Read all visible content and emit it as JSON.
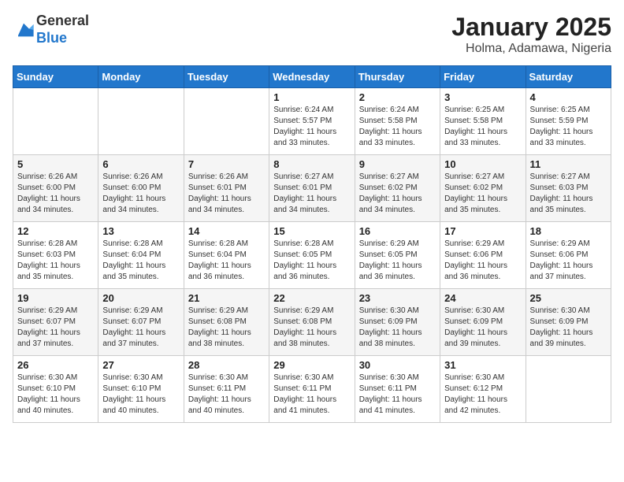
{
  "header": {
    "logo": {
      "line1": "General",
      "line2": "Blue"
    },
    "title": "January 2025",
    "subtitle": "Holma, Adamawa, Nigeria"
  },
  "weekdays": [
    "Sunday",
    "Monday",
    "Tuesday",
    "Wednesday",
    "Thursday",
    "Friday",
    "Saturday"
  ],
  "weeks": [
    [
      {
        "day": "",
        "info": ""
      },
      {
        "day": "",
        "info": ""
      },
      {
        "day": "",
        "info": ""
      },
      {
        "day": "1",
        "info": "Sunrise: 6:24 AM\nSunset: 5:57 PM\nDaylight: 11 hours and 33 minutes."
      },
      {
        "day": "2",
        "info": "Sunrise: 6:24 AM\nSunset: 5:58 PM\nDaylight: 11 hours and 33 minutes."
      },
      {
        "day": "3",
        "info": "Sunrise: 6:25 AM\nSunset: 5:58 PM\nDaylight: 11 hours and 33 minutes."
      },
      {
        "day": "4",
        "info": "Sunrise: 6:25 AM\nSunset: 5:59 PM\nDaylight: 11 hours and 33 minutes."
      }
    ],
    [
      {
        "day": "5",
        "info": "Sunrise: 6:26 AM\nSunset: 6:00 PM\nDaylight: 11 hours and 34 minutes."
      },
      {
        "day": "6",
        "info": "Sunrise: 6:26 AM\nSunset: 6:00 PM\nDaylight: 11 hours and 34 minutes."
      },
      {
        "day": "7",
        "info": "Sunrise: 6:26 AM\nSunset: 6:01 PM\nDaylight: 11 hours and 34 minutes."
      },
      {
        "day": "8",
        "info": "Sunrise: 6:27 AM\nSunset: 6:01 PM\nDaylight: 11 hours and 34 minutes."
      },
      {
        "day": "9",
        "info": "Sunrise: 6:27 AM\nSunset: 6:02 PM\nDaylight: 11 hours and 34 minutes."
      },
      {
        "day": "10",
        "info": "Sunrise: 6:27 AM\nSunset: 6:02 PM\nDaylight: 11 hours and 35 minutes."
      },
      {
        "day": "11",
        "info": "Sunrise: 6:27 AM\nSunset: 6:03 PM\nDaylight: 11 hours and 35 minutes."
      }
    ],
    [
      {
        "day": "12",
        "info": "Sunrise: 6:28 AM\nSunset: 6:03 PM\nDaylight: 11 hours and 35 minutes."
      },
      {
        "day": "13",
        "info": "Sunrise: 6:28 AM\nSunset: 6:04 PM\nDaylight: 11 hours and 35 minutes."
      },
      {
        "day": "14",
        "info": "Sunrise: 6:28 AM\nSunset: 6:04 PM\nDaylight: 11 hours and 36 minutes."
      },
      {
        "day": "15",
        "info": "Sunrise: 6:28 AM\nSunset: 6:05 PM\nDaylight: 11 hours and 36 minutes."
      },
      {
        "day": "16",
        "info": "Sunrise: 6:29 AM\nSunset: 6:05 PM\nDaylight: 11 hours and 36 minutes."
      },
      {
        "day": "17",
        "info": "Sunrise: 6:29 AM\nSunset: 6:06 PM\nDaylight: 11 hours and 36 minutes."
      },
      {
        "day": "18",
        "info": "Sunrise: 6:29 AM\nSunset: 6:06 PM\nDaylight: 11 hours and 37 minutes."
      }
    ],
    [
      {
        "day": "19",
        "info": "Sunrise: 6:29 AM\nSunset: 6:07 PM\nDaylight: 11 hours and 37 minutes."
      },
      {
        "day": "20",
        "info": "Sunrise: 6:29 AM\nSunset: 6:07 PM\nDaylight: 11 hours and 37 minutes."
      },
      {
        "day": "21",
        "info": "Sunrise: 6:29 AM\nSunset: 6:08 PM\nDaylight: 11 hours and 38 minutes."
      },
      {
        "day": "22",
        "info": "Sunrise: 6:29 AM\nSunset: 6:08 PM\nDaylight: 11 hours and 38 minutes."
      },
      {
        "day": "23",
        "info": "Sunrise: 6:30 AM\nSunset: 6:09 PM\nDaylight: 11 hours and 38 minutes."
      },
      {
        "day": "24",
        "info": "Sunrise: 6:30 AM\nSunset: 6:09 PM\nDaylight: 11 hours and 39 minutes."
      },
      {
        "day": "25",
        "info": "Sunrise: 6:30 AM\nSunset: 6:09 PM\nDaylight: 11 hours and 39 minutes."
      }
    ],
    [
      {
        "day": "26",
        "info": "Sunrise: 6:30 AM\nSunset: 6:10 PM\nDaylight: 11 hours and 40 minutes."
      },
      {
        "day": "27",
        "info": "Sunrise: 6:30 AM\nSunset: 6:10 PM\nDaylight: 11 hours and 40 minutes."
      },
      {
        "day": "28",
        "info": "Sunrise: 6:30 AM\nSunset: 6:11 PM\nDaylight: 11 hours and 40 minutes."
      },
      {
        "day": "29",
        "info": "Sunrise: 6:30 AM\nSunset: 6:11 PM\nDaylight: 11 hours and 41 minutes."
      },
      {
        "day": "30",
        "info": "Sunrise: 6:30 AM\nSunset: 6:11 PM\nDaylight: 11 hours and 41 minutes."
      },
      {
        "day": "31",
        "info": "Sunrise: 6:30 AM\nSunset: 6:12 PM\nDaylight: 11 hours and 42 minutes."
      },
      {
        "day": "",
        "info": ""
      }
    ]
  ]
}
